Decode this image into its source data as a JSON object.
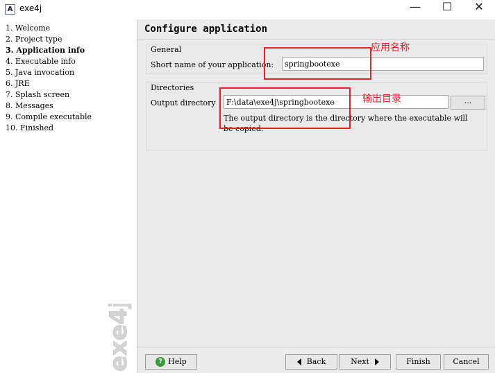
{
  "window": {
    "title": "exe4j",
    "minimize": "—",
    "maximize": "☐",
    "close": "✕"
  },
  "sidebar": {
    "steps": [
      "1. Welcome",
      "2. Project type",
      "3. Application info",
      "4. Executable info",
      "5. Java invocation",
      "6. JRE",
      "7. Splash screen",
      "8. Messages",
      "9. Compile executable",
      "10. Finished"
    ],
    "active_step": "3. Application info",
    "watermark": "exe4j"
  },
  "main": {
    "title": "Configure application",
    "general": {
      "legend": "General",
      "short_name_label": "Short name of your application:",
      "short_name_value": "springbootexe"
    },
    "directories": {
      "legend": "Directories",
      "output_label": "Output directory",
      "output_value": "F:\\data\\exe4j\\springbootexe",
      "browse_label": "...",
      "hint": "The output directory is the directory where the executable will be copied."
    }
  },
  "annotations": {
    "app_name": "应用名称",
    "output_dir": "输出目录",
    "color": "#e8202a"
  },
  "buttons": {
    "help": "Help",
    "back": "Back",
    "next": "Next",
    "finish": "Finish",
    "cancel": "Cancel"
  }
}
